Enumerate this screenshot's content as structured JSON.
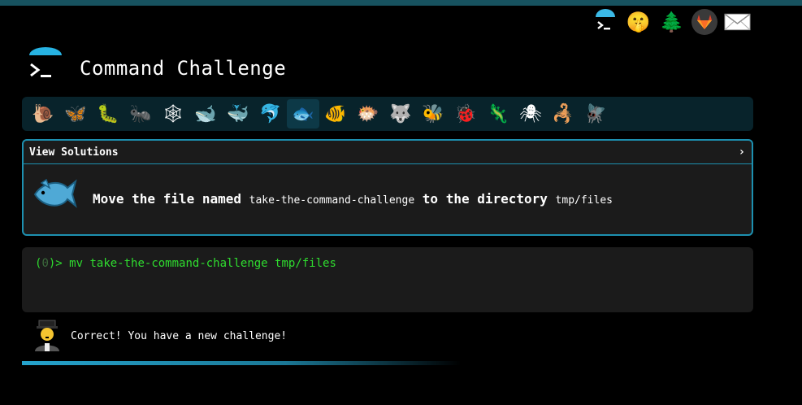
{
  "header": {
    "title": "Command Challenge",
    "icons": [
      {
        "name": "terminal-logo-icon",
        "glyph": ""
      },
      {
        "name": "shush-face-icon",
        "glyph": "🤫"
      },
      {
        "name": "tree-icon",
        "glyph": "🌲"
      },
      {
        "name": "gitlab-icon",
        "glyph": "🦊"
      },
      {
        "name": "mail-icon",
        "glyph": "✉"
      }
    ]
  },
  "levels": [
    {
      "name": "snail",
      "glyph": "🐌"
    },
    {
      "name": "butterfly",
      "glyph": "🦋"
    },
    {
      "name": "caterpillar",
      "glyph": "🐛"
    },
    {
      "name": "ant",
      "glyph": "🐜"
    },
    {
      "name": "spiderweb",
      "glyph": "🕸"
    },
    {
      "name": "whale",
      "glyph": "🐋"
    },
    {
      "name": "whale-2",
      "glyph": "🐳"
    },
    {
      "name": "dolphin",
      "glyph": "🐬"
    },
    {
      "name": "fish",
      "glyph": "🐟"
    },
    {
      "name": "tropical-fish",
      "glyph": "🐠"
    },
    {
      "name": "blowfish",
      "glyph": "🐡"
    },
    {
      "name": "wolf",
      "glyph": "🐺"
    },
    {
      "name": "bee",
      "glyph": "🐝"
    },
    {
      "name": "ladybug",
      "glyph": "🐞"
    },
    {
      "name": "lizard",
      "glyph": "🦎"
    },
    {
      "name": "spider",
      "glyph": "🕷"
    },
    {
      "name": "scorpion",
      "glyph": "🦂"
    },
    {
      "name": "fly",
      "glyph": "🪰"
    }
  ],
  "current_level": 8,
  "challenge": {
    "solutions_label": "View Solutions",
    "chevron": "›",
    "text_pre": "Move the file named ",
    "file": "take-the-command-challenge",
    "text_mid": " to the directory ",
    "dir": "tmp/files"
  },
  "terminal": {
    "prompt_open": "(",
    "prompt_count": "0",
    "prompt_close": ")> ",
    "command": "mv take-the-command-challenge tmp/files"
  },
  "feedback": {
    "message": "Correct! You have a new challenge!"
  },
  "colors": {
    "accent": "#1d90b0",
    "terminal_green": "#2fdc2f",
    "panel": "#1b1b1b",
    "levelbar": "#08232b"
  }
}
